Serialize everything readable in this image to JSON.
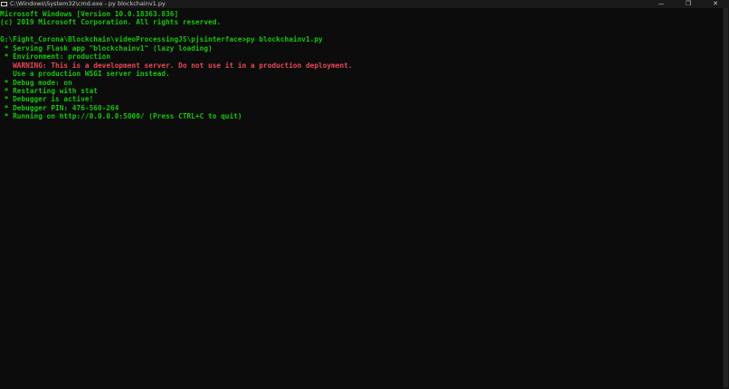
{
  "window": {
    "title": "C:\\Windows\\System32\\cmd.exe - py  blockchainv1.py",
    "icon": "cmd-icon",
    "controls": {
      "minimize": "—",
      "maximize": "❐",
      "close": "✕"
    }
  },
  "colors": {
    "background": "#0c0c0c",
    "text_green": "#16c60c",
    "text_red": "#e74856"
  },
  "console": {
    "lines": [
      {
        "text": "Microsoft Windows [Version 10.0.18363.836]",
        "color": "green"
      },
      {
        "text": "(c) 2019 Microsoft Corporation. All rights reserved.",
        "color": "green"
      },
      {
        "text": "",
        "color": "green"
      },
      {
        "text": "G:\\Fight_Corona\\Blockchain\\videoProcessingJS\\pjsinterface>py blockchainv1.py",
        "color": "green"
      },
      {
        "text": " * Serving Flask app \"blockchainv1\" (lazy loading)",
        "color": "green"
      },
      {
        "text": " * Environment: production",
        "color": "green"
      },
      {
        "text": "   WARNING: This is a development server. Do not use it in a production deployment.",
        "color": "red"
      },
      {
        "text": "   Use a production WSGI server instead.",
        "color": "green"
      },
      {
        "text": " * Debug mode: on",
        "color": "green"
      },
      {
        "text": " * Restarting with stat",
        "color": "green"
      },
      {
        "text": " * Debugger is active!",
        "color": "green"
      },
      {
        "text": " * Debugger PIN: 476-560-264",
        "color": "green"
      },
      {
        "text": " * Running on http://0.0.0.0:5000/ (Press CTRL+C to quit)",
        "color": "green"
      }
    ]
  }
}
